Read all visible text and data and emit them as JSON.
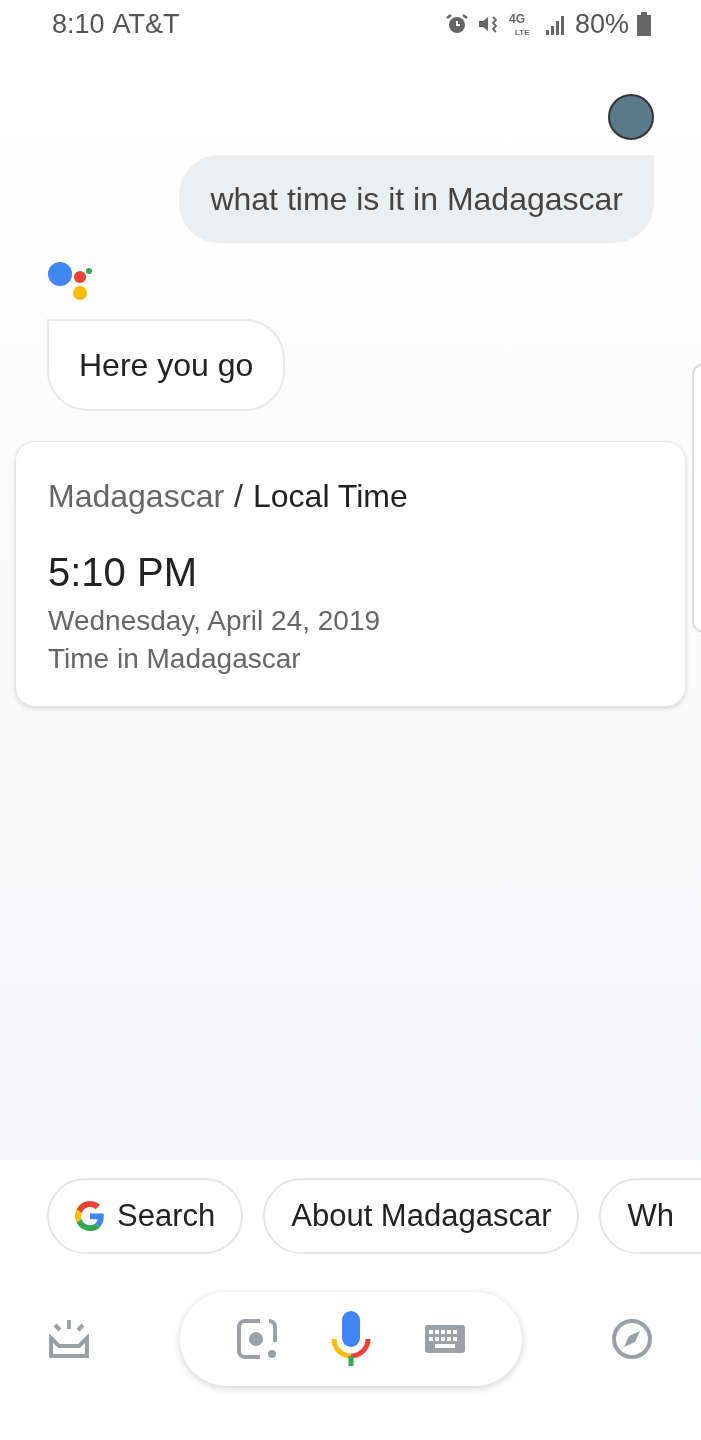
{
  "status_bar": {
    "time": "8:10",
    "carrier": "AT&T",
    "battery": "80%",
    "network": "4G",
    "network_sub": "LTE"
  },
  "conversation": {
    "user_query": "what time is it in Madagascar",
    "assistant_reply": "Here you go"
  },
  "time_card": {
    "place": "Madagascar",
    "separator": "/",
    "title": "Local Time",
    "time": "5:10 PM",
    "date": "Wednesday, April 24, 2019",
    "caption": "Time in Madagascar"
  },
  "suggestions": [
    {
      "kind": "search",
      "label": "Search"
    },
    {
      "kind": "plain",
      "label": "About Madagascar"
    },
    {
      "kind": "plain",
      "label": "Wh"
    }
  ]
}
